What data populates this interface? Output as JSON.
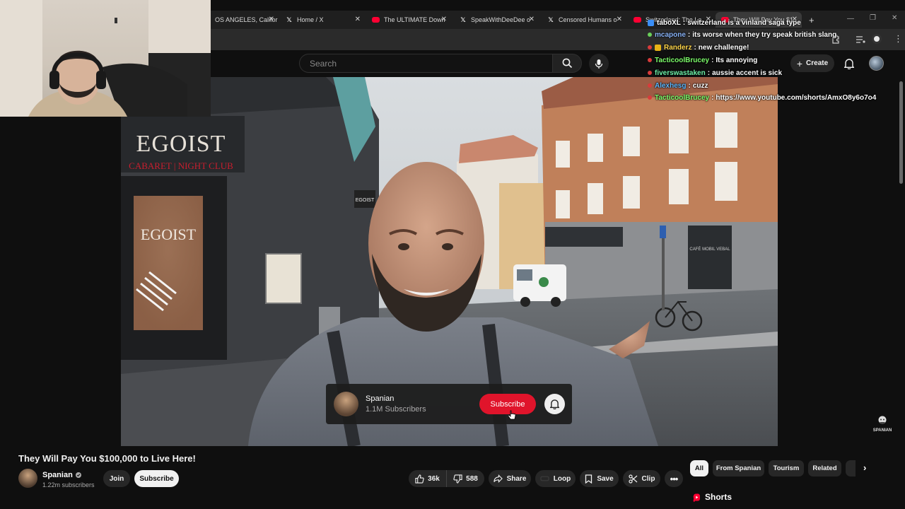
{
  "browser": {
    "tabs": [
      {
        "title": "OS ANGELES, Califor",
        "icon": "generic"
      },
      {
        "title": "Home / X",
        "icon": "x"
      },
      {
        "title": "The ULTIMATE Down",
        "icon": "youtube"
      },
      {
        "title": "SpeakWithDeeDee o",
        "icon": "x"
      },
      {
        "title": "Censored Humans o",
        "icon": "x"
      },
      {
        "title": "Switzerland: The La",
        "icon": "youtube"
      },
      {
        "title": "They Will Pay You $1",
        "icon": "youtube"
      }
    ],
    "new_tab": "+"
  },
  "header": {
    "search_placeholder": "Search",
    "create_label": "Create"
  },
  "chat": [
    {
      "user": "taboXL",
      "message": "switzerland is a vinland saga type",
      "color": "#ffffff"
    },
    {
      "user": "mcapone",
      "message": "its worse when they try speak british slang",
      "color": "#8ab4f8"
    },
    {
      "user": "Randerz",
      "message": "new challenge!",
      "color": "#ffd54a"
    },
    {
      "user": "TacticoolBrucey",
      "message": "Its annoying",
      "color": "#7cfc6a"
    },
    {
      "user": "fiverswastaken",
      "message": "aussie accent is sick",
      "color": "#6ef0a8"
    },
    {
      "user": "Alexhesg",
      "message": "cuzz",
      "color": "#5fb9ff"
    },
    {
      "user": "TacticoolBrucey",
      "message": "https://www.youtube.com/shorts/AmxO8y6o7o4",
      "color": "#7cfc6a"
    }
  ],
  "video": {
    "sign_main": "EGOIST",
    "sign_sub": "CABARET | NIGHT CLUB",
    "poster_text": "EGOIST",
    "small_sign": "EGOIST",
    "cafe_sign": "CAFÉ MOBIL VEBAL"
  },
  "subscribe_card": {
    "channel": "Spanian",
    "subscribers": "1.1M Subscribers",
    "button": "Subscribe"
  },
  "watermark": "SPANIAN",
  "below_video": {
    "title": "They Will Pay You $100,000 to Live Here!",
    "channel": "Spanian",
    "subscribers": "1.22m subscribers",
    "join": "Join",
    "subscribe": "Subscribe",
    "likes": "36k",
    "dislikes": "588",
    "share": "Share",
    "loop": "Loop",
    "save": "Save",
    "clip": "Clip"
  },
  "chips": [
    {
      "label": "All",
      "active": true
    },
    {
      "label": "From Spanian",
      "active": false
    },
    {
      "label": "Tourism",
      "active": false
    },
    {
      "label": "Related",
      "active": false
    }
  ],
  "shorts_heading": "Shorts",
  "colors": {
    "background": "#0f0f0f",
    "subscribe_red": "#e0142b",
    "youtube_red": "#ff0033"
  }
}
